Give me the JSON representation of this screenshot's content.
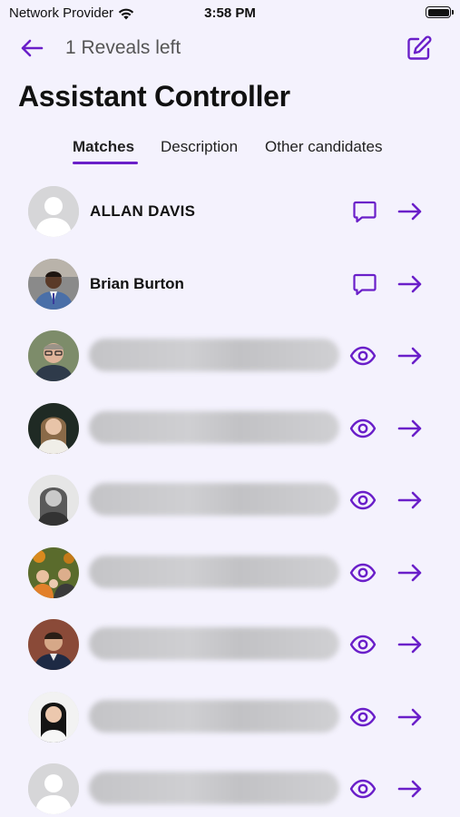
{
  "status_bar": {
    "carrier": "Network Provider",
    "time": "3:58 PM"
  },
  "header": {
    "reveals_left": "1 Reveals left",
    "title": "Assistant Controller"
  },
  "tabs": [
    {
      "label": "Matches",
      "active": true
    },
    {
      "label": "Description",
      "active": false
    },
    {
      "label": "Other candidates",
      "active": false
    }
  ],
  "colors": {
    "accent": "#6a1fc9",
    "background": "#f4f2fd",
    "blur": "#c8c8cb"
  },
  "candidates": [
    {
      "name": "ALLAN DAVIS",
      "revealed": true,
      "avatar": "placeholder"
    },
    {
      "name": "Brian Burton",
      "revealed": true,
      "avatar": "photo-suit-man"
    },
    {
      "name": "",
      "revealed": false,
      "avatar": "photo-man-glasses"
    },
    {
      "name": "",
      "revealed": false,
      "avatar": "photo-woman-dark"
    },
    {
      "name": "",
      "revealed": false,
      "avatar": "photo-woman-bw"
    },
    {
      "name": "",
      "revealed": false,
      "avatar": "photo-family"
    },
    {
      "name": "",
      "revealed": false,
      "avatar": "photo-man-brick"
    },
    {
      "name": "",
      "revealed": false,
      "avatar": "photo-woman-black-hair"
    },
    {
      "name": "",
      "revealed": false,
      "avatar": "placeholder"
    }
  ],
  "icons": {
    "back": "arrow-left-icon",
    "edit": "edit-icon",
    "chat": "chat-bubble-icon",
    "reveal": "eye-icon",
    "open": "arrow-right-icon"
  }
}
